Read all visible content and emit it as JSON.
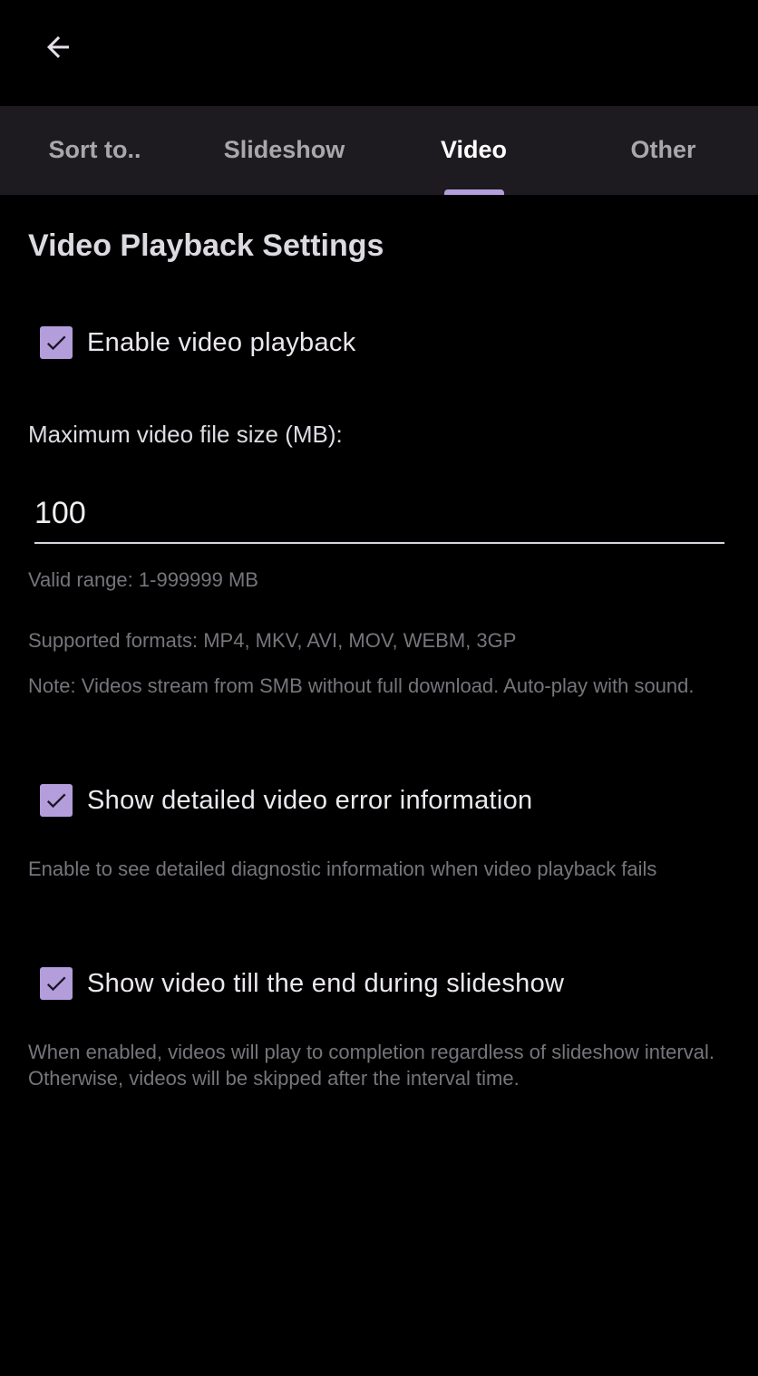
{
  "header": {
    "back_icon": "arrow-left-icon"
  },
  "tabs": [
    {
      "label": "Sort to..",
      "active": false
    },
    {
      "label": "Slideshow",
      "active": false
    },
    {
      "label": "Video",
      "active": true
    },
    {
      "label": "Other",
      "active": false
    }
  ],
  "colors": {
    "accent": "#b39ddb",
    "accent_check": "#1a1624",
    "tab_bar": "#1d1b1f"
  },
  "settings": {
    "title": "Video Playback Settings",
    "enable_playback": {
      "label": "Enable video playback",
      "checked": true
    },
    "max_size": {
      "label": "Maximum video file size (MB):",
      "value": "100",
      "valid_range": "Valid range: 1-999999 MB"
    },
    "supported_formats": "Supported formats: MP4, MKV, AVI, MOV, WEBM, 3GP",
    "note": "Note: Videos stream from SMB without full download. Auto-play with sound.",
    "detailed_errors": {
      "label": "Show detailed video error information",
      "checked": true,
      "hint": "Enable to see detailed diagnostic information when video playback fails"
    },
    "play_till_end": {
      "label": "Show video till the end during slideshow",
      "checked": true,
      "hint": "When enabled, videos will play to completion regardless of slideshow interval. Otherwise, videos will be skipped after the interval time."
    }
  }
}
